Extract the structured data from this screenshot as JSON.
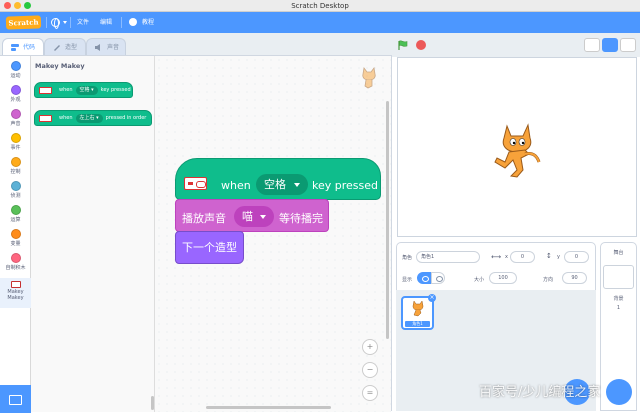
{
  "window": {
    "title": "Scratch Desktop"
  },
  "menubar": {
    "logo": "Scratch",
    "file": "文件",
    "edit": "编辑",
    "tutorials": "教程"
  },
  "tabs": {
    "code": "代码",
    "costumes": "造型",
    "sounds": "声音"
  },
  "categories": [
    {
      "label": "运动",
      "color": "#4c97ff"
    },
    {
      "label": "外观",
      "color": "#9966ff"
    },
    {
      "label": "声音",
      "color": "#cf63cf"
    },
    {
      "label": "事件",
      "color": "#ffbf00"
    },
    {
      "label": "控制",
      "color": "#ffab19"
    },
    {
      "label": "侦测",
      "color": "#5cb1d6"
    },
    {
      "label": "运算",
      "color": "#59c059"
    },
    {
      "label": "变量",
      "color": "#ff8c1a"
    },
    {
      "label": "自制积木",
      "color": "#ff6680"
    },
    {
      "label": "Makey Makey",
      "color": "#0fbd8c"
    }
  ],
  "palette": {
    "title": "Makey Makey",
    "block1": {
      "when": "when",
      "key": "空格",
      "suffix": "key pressed"
    },
    "block2": {
      "when": "when",
      "seq": "左上右",
      "suffix": "pressed in order"
    }
  },
  "script": {
    "hat": {
      "when": "when",
      "key": "空格",
      "suffix": "key pressed"
    },
    "sound": {
      "prefix": "播放声音",
      "value": "喵",
      "suffix": "等待播完"
    },
    "looks": {
      "label": "下一个造型"
    }
  },
  "zoom": {
    "in": "+",
    "out": "−",
    "reset": "="
  },
  "sprite_info": {
    "sprite_label": "角色",
    "sprite_name": "角色1",
    "x_label": "x",
    "x_value": "0",
    "y_label": "y",
    "y_value": "0",
    "show_label": "显示",
    "size_label": "大小",
    "size_value": "100",
    "direction_label": "方向",
    "direction_value": "90"
  },
  "sprite_tile": {
    "name": "角色1"
  },
  "stage_panel": {
    "title": "舞台",
    "backdrops_label": "背景",
    "backdrops_count": "1"
  },
  "watermark": "百家号/少儿编程之家",
  "colors": {
    "accent": "#4c97ff",
    "events": "#0fbd8c",
    "sound": "#cf63cf",
    "looks": "#9966ff"
  }
}
